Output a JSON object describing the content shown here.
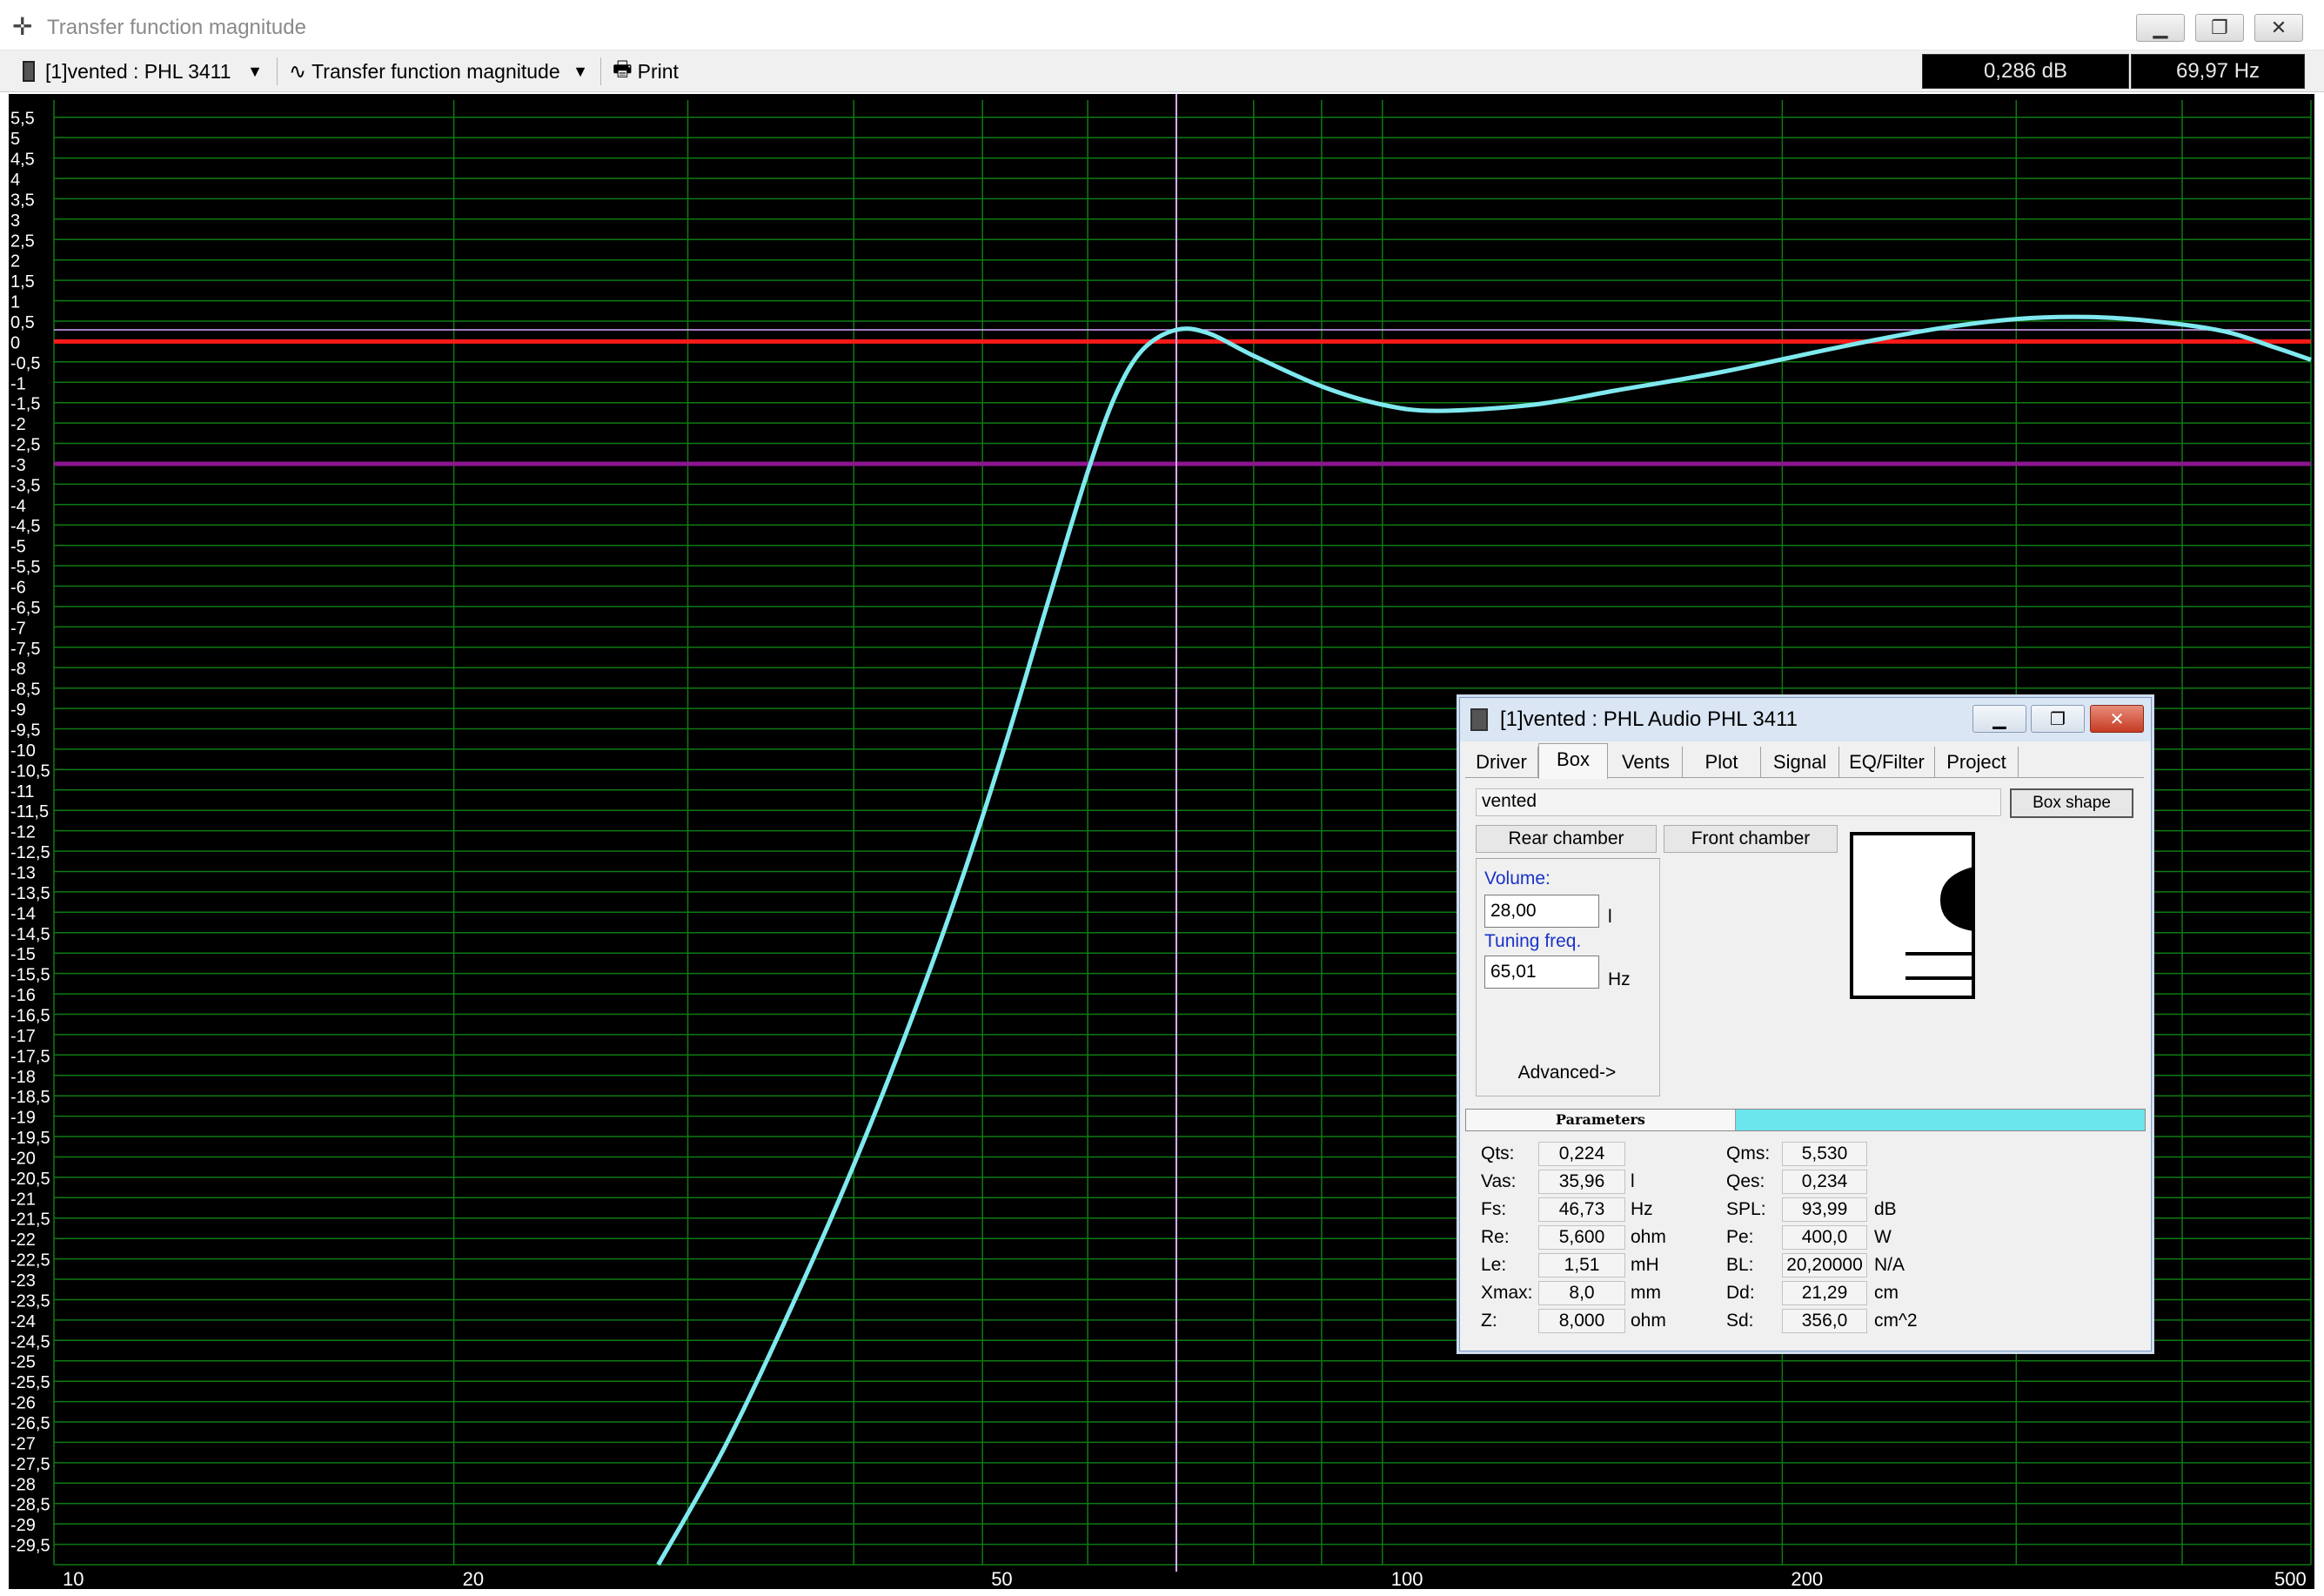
{
  "window": {
    "title": "Transfer function magnitude"
  },
  "toolbar": {
    "project_select": "[1]vented : PHL 3411",
    "view_select": "Transfer function magnitude",
    "print_label": "Print",
    "readout_db": "0,286 dB",
    "readout_hz": "69,97 Hz"
  },
  "colors": {
    "plot_background": "#000000",
    "grid": "#0e7a12",
    "curve": "#7fe9ef",
    "reference_0db": "#ff1a1a",
    "reference_minus3db": "#8c168f",
    "cursor": "#dba9ff",
    "axis_text": "#ffffff"
  },
  "chart_data": {
    "type": "line",
    "title": "",
    "xlabel": "",
    "ylabel": "",
    "x_scale": "log",
    "xlim": [
      10,
      500
    ],
    "ylim": [
      -30,
      5.75
    ],
    "x_tick_labels": [
      "10",
      "20",
      "50",
      "100",
      "200",
      "500"
    ],
    "x_tick_values": [
      10,
      20,
      50,
      100,
      200,
      500
    ],
    "x_grid": [
      10,
      20,
      30,
      40,
      50,
      60,
      70,
      80,
      90,
      100,
      200,
      300,
      400,
      500
    ],
    "y_tick_labels": [
      "5,5",
      "5",
      "4,5",
      "4",
      "3,5",
      "3",
      "2,5",
      "2",
      "1,5",
      "1",
      "0,5",
      "0",
      "-0,5",
      "-1",
      "-1,5",
      "-2",
      "-2,5",
      "-3",
      "-3,5",
      "-4",
      "-4,5",
      "-5",
      "-5,5",
      "-6",
      "-6,5",
      "-7",
      "-7,5",
      "-8",
      "-8,5",
      "-9",
      "-9,5",
      "-10",
      "-10,5",
      "-11",
      "-11,5",
      "-12",
      "-12,5",
      "-13",
      "-13,5",
      "-14",
      "-14,5",
      "-15",
      "-15,5",
      "-16",
      "-16,5",
      "-17",
      "-17,5",
      "-18",
      "-18,5",
      "-19",
      "-19,5",
      "-20",
      "-20,5",
      "-21",
      "-21,5",
      "-22",
      "-22,5",
      "-23",
      "-23,5",
      "-24",
      "-24,5",
      "-25",
      "-25,5",
      "-26",
      "-26,5",
      "-27",
      "-27,5",
      "-28",
      "-28,5",
      "-29",
      "-29,5"
    ],
    "grid": true,
    "series": [
      {
        "x": [
          28.5,
          32,
          36,
          40,
          44,
          48,
          52,
          56,
          60,
          63,
          66,
          69.97,
          74,
          80,
          90,
          100,
          110,
          130,
          150,
          180,
          220,
          260,
          300,
          340,
          380,
          430,
          470,
          500
        ],
        "y": [
          -30,
          -27.1,
          -23.6,
          -20.2,
          -16.8,
          -13.4,
          -9.9,
          -6.4,
          -3.2,
          -1.3,
          -0.2,
          0.286,
          0.2,
          -0.35,
          -1.1,
          -1.55,
          -1.7,
          -1.55,
          -1.2,
          -0.75,
          -0.15,
          0.3,
          0.55,
          0.6,
          0.5,
          0.25,
          -0.15,
          -0.45
        ]
      }
    ],
    "reference_lines": [
      0,
      -3
    ],
    "cursor": {
      "x": 69.97,
      "y": 0.286
    }
  },
  "dialog": {
    "title": "[1]vented : PHL Audio PHL 3411",
    "tabs": [
      "Driver",
      "Box",
      "Vents",
      "Plot",
      "Signal",
      "EQ/Filter",
      "Project"
    ],
    "active_tab": "Box",
    "box_name": "vented",
    "box_shape_button": "Box shape",
    "rear_chamber_button": "Rear chamber",
    "front_chamber_button": "Front chamber",
    "volume_label": "Volume:",
    "volume_value": "28,00",
    "volume_unit": "l",
    "tuning_label": "Tuning freq.",
    "tuning_value": "65,01",
    "tuning_unit": "Hz",
    "advanced_button": "Advanced->",
    "parameters_tab": "Parameters",
    "params_left": [
      {
        "label": "Qts:",
        "value": "0,224",
        "unit": ""
      },
      {
        "label": "Vas:",
        "value": "35,96",
        "unit": "l"
      },
      {
        "label": "Fs:",
        "value": "46,73",
        "unit": "Hz"
      },
      {
        "label": "Re:",
        "value": "5,600",
        "unit": "ohm"
      },
      {
        "label": "Le:",
        "value": "1,51",
        "unit": "mH"
      },
      {
        "label": "Xmax:",
        "value": "8,0",
        "unit": "mm"
      },
      {
        "label": "Z:",
        "value": "8,000",
        "unit": "ohm"
      }
    ],
    "params_right": [
      {
        "label": "Qms:",
        "value": "5,530",
        "unit": ""
      },
      {
        "label": "Qes:",
        "value": "0,234",
        "unit": ""
      },
      {
        "label": "SPL:",
        "value": "93,99",
        "unit": "dB"
      },
      {
        "label": "Pe:",
        "value": "400,0",
        "unit": "W"
      },
      {
        "label": "BL:",
        "value": "20,20000",
        "unit": "N/A"
      },
      {
        "label": "Dd:",
        "value": "21,29",
        "unit": "cm"
      },
      {
        "label": "Sd:",
        "value": "356,0",
        "unit": "cm^2"
      }
    ]
  }
}
